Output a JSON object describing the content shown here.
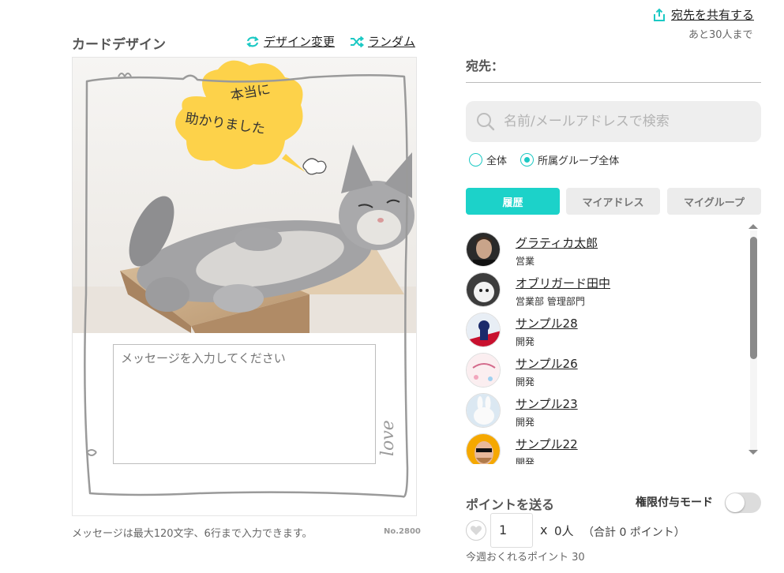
{
  "share": {
    "label": "宛先を共有する",
    "note": "あと30人まで"
  },
  "card": {
    "section_title": "カードデザイン",
    "change_design_label": "デザイン変更",
    "random_label": "ランダム",
    "bubble_line1": "本当に",
    "bubble_line2": "助かりました",
    "frame_text": "love",
    "message_placeholder": "メッセージを入力してください",
    "note": "メッセージは最大120文字、6行まで入力できます。",
    "number": "No.2800"
  },
  "recipients": {
    "label": "宛先：",
    "search_placeholder": "名前/メールアドレスで検索",
    "radio_all": "全体",
    "radio_group": "所属グループ全体",
    "tabs": [
      "履歴",
      "マイアドレス",
      "マイグループ"
    ],
    "people": [
      {
        "name": "グラティカ太郎",
        "dept": "営業"
      },
      {
        "name": "オブリガード田中",
        "dept": "営業部 管理部門"
      },
      {
        "name": "サンプル28",
        "dept": "開発"
      },
      {
        "name": "サンプル26",
        "dept": "開発"
      },
      {
        "name": "サンプル23",
        "dept": "開発"
      },
      {
        "name": "サンプル22",
        "dept": "開発"
      }
    ]
  },
  "points": {
    "title": "ポイントを送る",
    "mode_label": "権限付与モード",
    "quantity": "1",
    "times": "x",
    "count": "0人",
    "total": "（合計 0 ポイント）",
    "weekly": "今週おくれるポイント 30"
  },
  "colors": {
    "accent": "#1cd2c9",
    "bubble": "#fdd24a"
  },
  "icons": [
    "share-icon",
    "swap-icon",
    "shuffle-icon",
    "search-icon",
    "heart-icon"
  ]
}
